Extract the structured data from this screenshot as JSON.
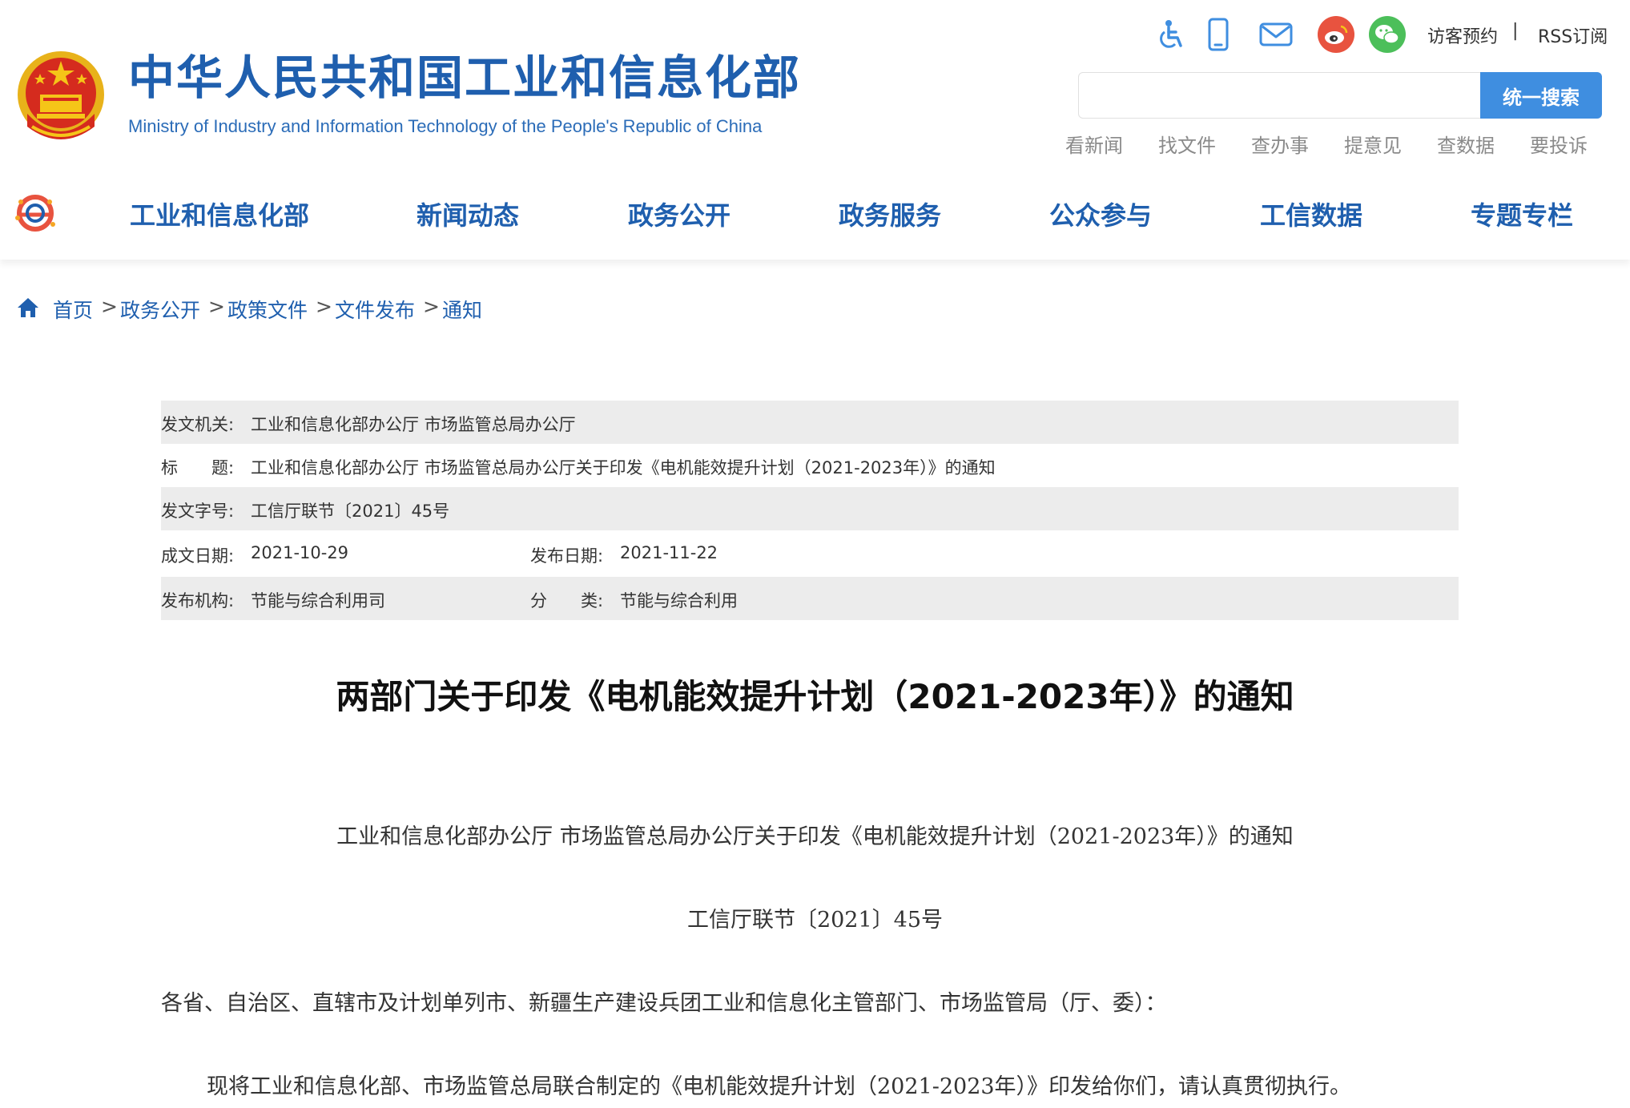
{
  "header": {
    "title_cn": "中华人民共和国工业和信息化部",
    "title_en": "Ministry of Industry and Information Technology of the People's Republic of China",
    "top_links": [
      "访客预约",
      "RSS订阅"
    ],
    "top_separator": "|",
    "icons": [
      "accessibility-icon",
      "mobile-icon",
      "mail-icon",
      "weibo-icon",
      "wechat-icon"
    ],
    "search": {
      "placeholder": "",
      "button_label": "统一搜索"
    },
    "quick_links": [
      "看新闻",
      "找文件",
      "查办事",
      "提意见",
      "查数据",
      "要投诉"
    ]
  },
  "nav": {
    "items": [
      "工业和信息化部",
      "新闻动态",
      "政务公开",
      "政务服务",
      "公众参与",
      "工信数据",
      "专题专栏"
    ]
  },
  "breadcrumb": {
    "items": [
      "首页",
      "政务公开",
      "政策文件",
      "文件发布",
      "通知"
    ],
    "separator": ">"
  },
  "meta": {
    "issuer_label": "发文机关:",
    "issuer": "工业和信息化部办公厅 市场监管总局办公厅",
    "title_label": "标　　题:",
    "title": "工业和信息化部办公厅 市场监管总局办公厅关于印发《电机能效提升计划（2021-2023年）》的通知",
    "doc_no_label": "发文字号:",
    "doc_no": "工信厅联节〔2021〕45号",
    "created_label": "成文日期:",
    "created": "2021-10-29",
    "published_label": "发布日期:",
    "published": "2021-11-22",
    "org_label": "发布机构:",
    "org": "节能与综合利用司",
    "category_label": "分　　类:",
    "category": "节能与综合利用"
  },
  "article": {
    "title": "两部门关于印发《电机能效提升计划（2021-2023年）》的通知",
    "subtitle": "工业和信息化部办公厅  市场监管总局办公厅关于印发《电机能效提升计划（2021-2023年）》的通知",
    "doc_no": "工信厅联节〔2021〕45号",
    "salutation": "各省、自治区、直辖市及计划单列市、新疆生产建设兵团工业和信息化主管部门、市场监管局（厅、委）：",
    "paragraph1": "现将工业和信息化部、市场监管总局联合制定的《电机能效提升计划（2021-2023年）》印发给你们，请认真贯彻执行。"
  },
  "colors": {
    "brand_blue": "#1f5fae",
    "search_button": "#3f8ee0",
    "meta_shade": "#ececec",
    "emblem_red": "#d52b1e",
    "emblem_gold": "#f5c518"
  }
}
